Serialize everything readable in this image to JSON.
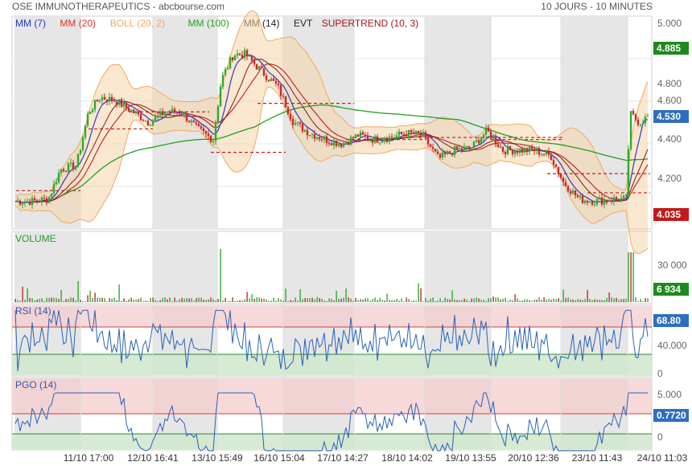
{
  "header": {
    "title": "OSE IMMUNOTHERAPEUTICS - abcbourse.com",
    "period": "10 JOURS - 10 MINUTES"
  },
  "legend": [
    {
      "label": "MM (7)",
      "color": "#2b39c8"
    },
    {
      "label": "MM (20)",
      "color": "#e03030"
    },
    {
      "label": "BOLL (20, 2)",
      "color": "#f0a860"
    },
    {
      "label": "MM (100)",
      "color": "#20a020"
    },
    {
      "label": "MM (14)",
      "color": "#222222"
    },
    {
      "label": "EVT",
      "color": "#222222"
    },
    {
      "label": "SUPERTREND (10, 3)",
      "color": "#a01818"
    }
  ],
  "x_labels": [
    "11/10 17:00",
    "12/10 16:41",
    "13/10 15:49",
    "16/10 15:04",
    "17/10 14:27",
    "18/10 14:02",
    "19/10 13:55",
    "20/10 12:36",
    "23/10 11:43",
    "24/10 11:03"
  ],
  "chart_data": [
    {
      "type": "candlestick",
      "ylim": [
        4.0,
        5.0
      ],
      "yticks": [
        "5.000",
        "4.800",
        "4.600",
        "4.400",
        "4.200"
      ],
      "badges": {
        "high": "4.885",
        "last": "4.530",
        "low": "4.035"
      },
      "x": [
        "11/10 17:00",
        "12/10 16:41",
        "13/10 15:49",
        "16/10 15:04",
        "17/10 14:27",
        "18/10 14:02",
        "19/10 13:55",
        "20/10 12:36",
        "23/10 11:43",
        "24/10 11:03"
      ],
      "series": [
        {
          "name": "MM (7)",
          "values": [
            4.45,
            4.55,
            4.48,
            4.8,
            4.43,
            4.47,
            4.42,
            4.34,
            4.13,
            4.47
          ]
        }
      ]
    },
    {
      "type": "bar",
      "title": "VOLUME",
      "yticks": [
        "30 000"
      ],
      "badge": "6 934"
    },
    {
      "type": "line",
      "title": "RSI (14)",
      "ylim": [
        0,
        100
      ],
      "yticks": [
        "40.000",
        "0"
      ],
      "badge": "68.80"
    },
    {
      "type": "line",
      "title": "PGO (14)",
      "yticks": [
        "5.000",
        "0"
      ],
      "badge": "0.7720"
    }
  ]
}
